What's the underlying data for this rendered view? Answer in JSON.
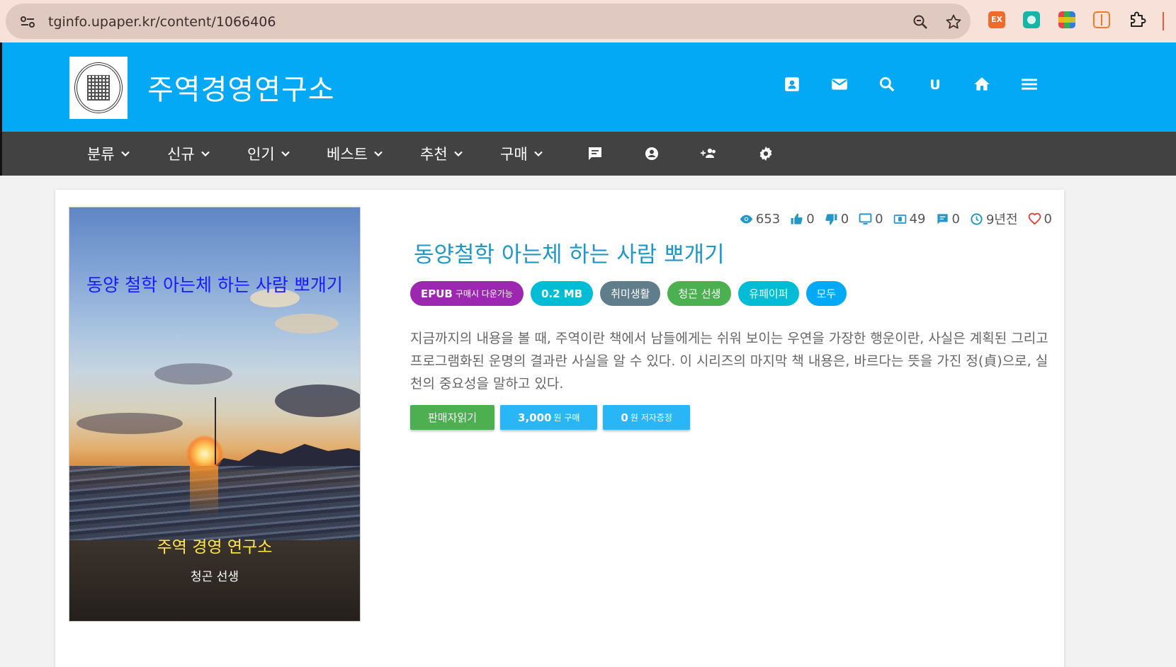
{
  "browser": {
    "url": "tginfo.upaper.kr/content/1066406",
    "extension_ex_label": "EX"
  },
  "header": {
    "site_title": "주역경영연구소",
    "icons": [
      "contact-card-icon",
      "mail-icon",
      "search-icon",
      "u-icon",
      "home-icon",
      "menu-icon"
    ],
    "u_label": "U"
  },
  "nav": {
    "items": [
      {
        "label": "분류"
      },
      {
        "label": "신규"
      },
      {
        "label": "인기"
      },
      {
        "label": "베스트"
      },
      {
        "label": "추천"
      },
      {
        "label": "구매"
      }
    ],
    "icons": [
      "chat-icon",
      "account-circle-icon",
      "group-add-icon",
      "settings-icon"
    ]
  },
  "cover": {
    "title": "동양 철학 아는체 하는 사람 뽀개기",
    "publisher": "주역 경영 연구소",
    "author": "청곤 선생"
  },
  "stats": {
    "views": "653",
    "likes": "0",
    "dislikes": "0",
    "screens": "0",
    "money": "49",
    "comments": "0",
    "time": "9년전",
    "hearts": "0"
  },
  "book": {
    "title": "동양철학 아는체 하는 사람 뽀개기",
    "description": "지금까지의 내용을 볼 때, 주역이란 책에서 남들에게는 쉬워 보이는 우연을 가장한 행운이란, 사실은 계획된 그리고 프로그램화된 운명의 결과란 사실을 알 수 있다. 이 시리즈의 마지막 책 내용은, 바르다는 뜻을 가진 정(貞)으로, 실천의 중요성을 말하고 있다."
  },
  "tags": {
    "epub_main": "EPUB",
    "epub_sub": "구매시 다운가능",
    "size": "0.2 MB",
    "category": "취미생활",
    "author": "청곤 선생",
    "publisher": "유페이퍼",
    "audience": "모두"
  },
  "actions": {
    "read_label": "판매자읽기",
    "buy_price": "3,000",
    "buy_suffix": "원 구매",
    "gift_price": "0",
    "gift_suffix": "원 저자증정"
  },
  "colors": {
    "header": "#03a9f4",
    "nav": "#424242",
    "title": "#2196c9"
  }
}
